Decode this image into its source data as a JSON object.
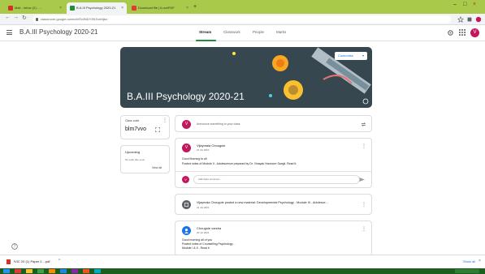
{
  "browser": {
    "tabs": [
      {
        "label": "Mail - Inbox (2) - …",
        "favicon_color": "#d93025"
      },
      {
        "label": "B.A.III Psychology 2020-21",
        "favicon_color": "#1e8e3e"
      },
      {
        "label": "Download file | iLovePDF",
        "favicon_color": "#e53935"
      }
    ],
    "new_tab": "+",
    "url": "classroom.google.com/c/MTc0NDY3NTcxMjAz"
  },
  "app": {
    "class_title": "B.A.III Psychology 2020-21",
    "nav_tabs": [
      "Stream",
      "Classwork",
      "People",
      "Marks"
    ],
    "avatar_letter": "V",
    "accent_color": "#1e8e3e"
  },
  "banner": {
    "title": "B.A.III Psychology 2020-21",
    "customise_label": "Customise"
  },
  "class_code": {
    "label": "Class code",
    "code": "blm7vvo"
  },
  "upcoming": {
    "title": "Upcoming",
    "empty_text": "No work due soon",
    "view_all": "View all"
  },
  "announce": {
    "placeholder": "Announce something to your class"
  },
  "posts": [
    {
      "author": "Vijaymala Chougule",
      "date": "21 Jul 2021",
      "avatar_letter": "V",
      "avatar_color": "#c2185b",
      "lines": [
        "Good Morning to all",
        "Posted notes of Module II - Adolescence prepared by Dr. Vinayak Honmore Sangli. Read it."
      ],
      "comment_placeholder": "Add class comment..."
    },
    {
      "author_line": "Vijaymala Chougule posted a new material: Developmental Psychology - Module III - Adolesce...",
      "date": "21 Jul 2021",
      "avatar_color": "#5f6368"
    },
    {
      "author": "Chougule varsha",
      "date": "20 Jul 2021",
      "avatar_color": "#1a73e8",
      "lines": [
        "Good morning all of you",
        "Posted notes of Counselling Psychology -",
        "Module I & II . Read it"
      ]
    }
  ],
  "download": {
    "file": "IVIC 20 (1) Paper 2....pdf",
    "show_all": "Show all"
  }
}
